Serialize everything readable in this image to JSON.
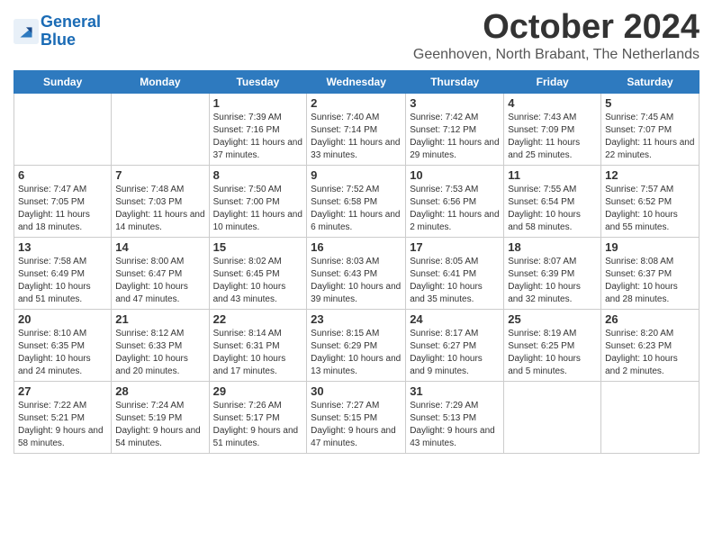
{
  "header": {
    "logo_line1": "General",
    "logo_line2": "Blue",
    "month": "October 2024",
    "location": "Geenhoven, North Brabant, The Netherlands"
  },
  "days_of_week": [
    "Sunday",
    "Monday",
    "Tuesday",
    "Wednesday",
    "Thursday",
    "Friday",
    "Saturday"
  ],
  "weeks": [
    [
      {
        "day": "",
        "info": ""
      },
      {
        "day": "",
        "info": ""
      },
      {
        "day": "1",
        "info": "Sunrise: 7:39 AM\nSunset: 7:16 PM\nDaylight: 11 hours and 37 minutes."
      },
      {
        "day": "2",
        "info": "Sunrise: 7:40 AM\nSunset: 7:14 PM\nDaylight: 11 hours and 33 minutes."
      },
      {
        "day": "3",
        "info": "Sunrise: 7:42 AM\nSunset: 7:12 PM\nDaylight: 11 hours and 29 minutes."
      },
      {
        "day": "4",
        "info": "Sunrise: 7:43 AM\nSunset: 7:09 PM\nDaylight: 11 hours and 25 minutes."
      },
      {
        "day": "5",
        "info": "Sunrise: 7:45 AM\nSunset: 7:07 PM\nDaylight: 11 hours and 22 minutes."
      }
    ],
    [
      {
        "day": "6",
        "info": "Sunrise: 7:47 AM\nSunset: 7:05 PM\nDaylight: 11 hours and 18 minutes."
      },
      {
        "day": "7",
        "info": "Sunrise: 7:48 AM\nSunset: 7:03 PM\nDaylight: 11 hours and 14 minutes."
      },
      {
        "day": "8",
        "info": "Sunrise: 7:50 AM\nSunset: 7:00 PM\nDaylight: 11 hours and 10 minutes."
      },
      {
        "day": "9",
        "info": "Sunrise: 7:52 AM\nSunset: 6:58 PM\nDaylight: 11 hours and 6 minutes."
      },
      {
        "day": "10",
        "info": "Sunrise: 7:53 AM\nSunset: 6:56 PM\nDaylight: 11 hours and 2 minutes."
      },
      {
        "day": "11",
        "info": "Sunrise: 7:55 AM\nSunset: 6:54 PM\nDaylight: 10 hours and 58 minutes."
      },
      {
        "day": "12",
        "info": "Sunrise: 7:57 AM\nSunset: 6:52 PM\nDaylight: 10 hours and 55 minutes."
      }
    ],
    [
      {
        "day": "13",
        "info": "Sunrise: 7:58 AM\nSunset: 6:49 PM\nDaylight: 10 hours and 51 minutes."
      },
      {
        "day": "14",
        "info": "Sunrise: 8:00 AM\nSunset: 6:47 PM\nDaylight: 10 hours and 47 minutes."
      },
      {
        "day": "15",
        "info": "Sunrise: 8:02 AM\nSunset: 6:45 PM\nDaylight: 10 hours and 43 minutes."
      },
      {
        "day": "16",
        "info": "Sunrise: 8:03 AM\nSunset: 6:43 PM\nDaylight: 10 hours and 39 minutes."
      },
      {
        "day": "17",
        "info": "Sunrise: 8:05 AM\nSunset: 6:41 PM\nDaylight: 10 hours and 35 minutes."
      },
      {
        "day": "18",
        "info": "Sunrise: 8:07 AM\nSunset: 6:39 PM\nDaylight: 10 hours and 32 minutes."
      },
      {
        "day": "19",
        "info": "Sunrise: 8:08 AM\nSunset: 6:37 PM\nDaylight: 10 hours and 28 minutes."
      }
    ],
    [
      {
        "day": "20",
        "info": "Sunrise: 8:10 AM\nSunset: 6:35 PM\nDaylight: 10 hours and 24 minutes."
      },
      {
        "day": "21",
        "info": "Sunrise: 8:12 AM\nSunset: 6:33 PM\nDaylight: 10 hours and 20 minutes."
      },
      {
        "day": "22",
        "info": "Sunrise: 8:14 AM\nSunset: 6:31 PM\nDaylight: 10 hours and 17 minutes."
      },
      {
        "day": "23",
        "info": "Sunrise: 8:15 AM\nSunset: 6:29 PM\nDaylight: 10 hours and 13 minutes."
      },
      {
        "day": "24",
        "info": "Sunrise: 8:17 AM\nSunset: 6:27 PM\nDaylight: 10 hours and 9 minutes."
      },
      {
        "day": "25",
        "info": "Sunrise: 8:19 AM\nSunset: 6:25 PM\nDaylight: 10 hours and 5 minutes."
      },
      {
        "day": "26",
        "info": "Sunrise: 8:20 AM\nSunset: 6:23 PM\nDaylight: 10 hours and 2 minutes."
      }
    ],
    [
      {
        "day": "27",
        "info": "Sunrise: 7:22 AM\nSunset: 5:21 PM\nDaylight: 9 hours and 58 minutes."
      },
      {
        "day": "28",
        "info": "Sunrise: 7:24 AM\nSunset: 5:19 PM\nDaylight: 9 hours and 54 minutes."
      },
      {
        "day": "29",
        "info": "Sunrise: 7:26 AM\nSunset: 5:17 PM\nDaylight: 9 hours and 51 minutes."
      },
      {
        "day": "30",
        "info": "Sunrise: 7:27 AM\nSunset: 5:15 PM\nDaylight: 9 hours and 47 minutes."
      },
      {
        "day": "31",
        "info": "Sunrise: 7:29 AM\nSunset: 5:13 PM\nDaylight: 9 hours and 43 minutes."
      },
      {
        "day": "",
        "info": ""
      },
      {
        "day": "",
        "info": ""
      }
    ]
  ]
}
